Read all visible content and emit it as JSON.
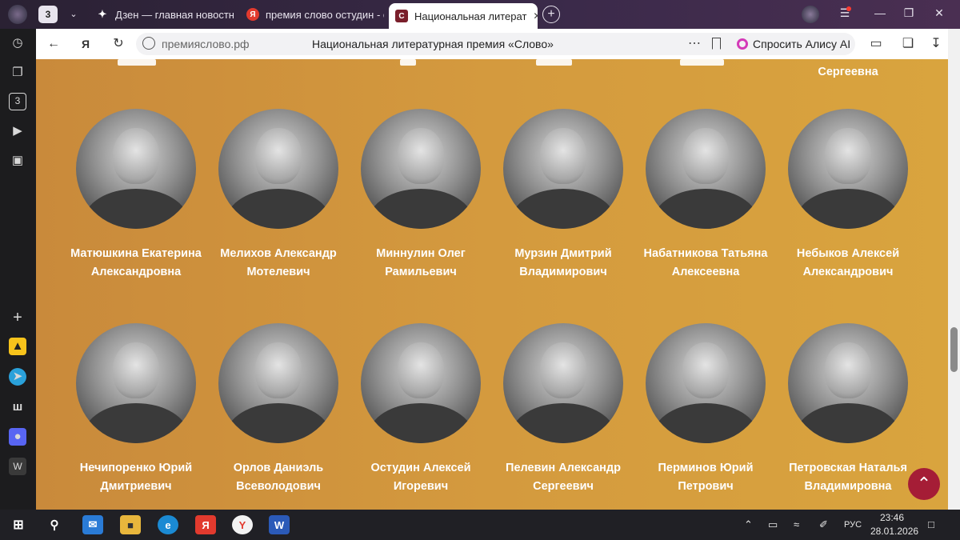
{
  "browser": {
    "tab_counter": "3",
    "tabs": [
      {
        "label": "Дзен — главная новостна",
        "favicon": "sparkle-icon"
      },
      {
        "label": "премия слово остудин - с",
        "favicon": "yandex-icon"
      },
      {
        "label": "Национальная литерат",
        "favicon": "slovo-icon"
      }
    ],
    "address": {
      "domain": "премияслово.рф",
      "page_title": "Национальная литературная премия «Слово»",
      "more": "⋯"
    },
    "alice_label": "Спросить Алису AI",
    "sidebar_counter": "3"
  },
  "page": {
    "previous_row_partial_name": "Сергеевна",
    "people": [
      {
        "name": "Матюшкина Екатерина Александровна"
      },
      {
        "name": "Мелихов Александр Мотелевич"
      },
      {
        "name": "Миннулин Олег Рамильевич"
      },
      {
        "name": "Мурзин Дмитрий Владимирович"
      },
      {
        "name": "Набатникова Татьяна Алексеевна"
      },
      {
        "name": "Небыков Алексей Александрович"
      },
      {
        "name": "Нечипоренко Юрий Дмитриевич"
      },
      {
        "name": "Орлов Даниэль Всеволодович"
      },
      {
        "name": "Остудин Алексей Игоревич"
      },
      {
        "name": "Пелевин Александр Сергеевич"
      },
      {
        "name": "Перминов Юрий Петрович"
      },
      {
        "name": "Петровская Наталья Владимировна"
      }
    ],
    "scroll_top_icon": "chevron-up-icon"
  },
  "taskbar": {
    "language": "РУС",
    "time": "23:46",
    "date": "28.01.2026"
  },
  "colors": {
    "content_bg_start": "#c98a3b",
    "content_bg_end": "#d9a43e",
    "accent_button": "#a51d36",
    "tabbar": "#3b2a4a"
  }
}
